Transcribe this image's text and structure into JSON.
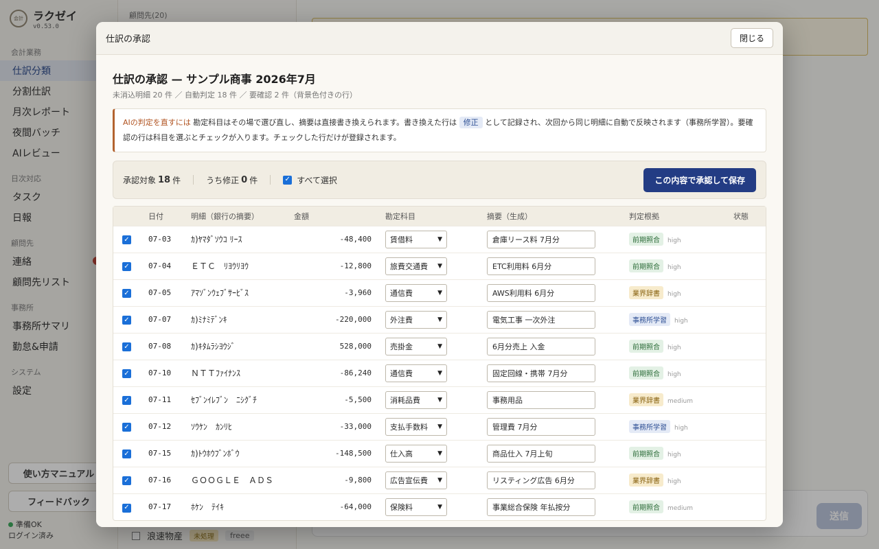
{
  "sidebar": {
    "logo_text": "会計",
    "brand": "ラクゼイ",
    "version": "v0.53.0",
    "groups": [
      {
        "label": "会計業務",
        "items": [
          "仕訳分類",
          "分割仕訳",
          "月次レポート",
          "夜間バッチ",
          "AIレビュー"
        ]
      },
      {
        "label": "日次対応",
        "items": [
          "タスク",
          "日報"
        ]
      },
      {
        "label": "顧問先",
        "items": [
          "連絡",
          "顧問先リスト"
        ]
      },
      {
        "label": "事務所",
        "items": [
          "事務所サマリ",
          "勤怠&申請"
        ]
      },
      {
        "label": "システム",
        "items": [
          "設定"
        ]
      }
    ],
    "manual_button": "使い方マニュアル",
    "feedback_button": "フィードバック",
    "status_ready": "準備OK",
    "status_login": "ログイン済み"
  },
  "clients": {
    "title": "顧問先(20)",
    "bottom_item": "浪速物産",
    "bottom_status": "未処理",
    "bottom_tag": "freee"
  },
  "composer": {
    "send_label": "送信"
  },
  "modal": {
    "header_title": "仕訳の承認",
    "close_label": "閉じる",
    "title": "仕訳の承認 — サンプル商事 2026年7月",
    "subtitle": "未消込明細 20 件 ／ 自動判定 18 件 ／ 要確認 2 件（背景色付きの行）",
    "hint": {
      "strong": "AIの判定を直すには",
      "text1": "勘定科目はその場で選び直し、摘要は直接書き換えられます。書き換えた行は",
      "chip": "修正",
      "text2": "として記録され、次回から同じ明細に自動で反映されます（事務所学習）。要確認の行は科目を選ぶとチェックが入ります。チェックした行だけが登録されます。"
    },
    "action_bar": {
      "target_label": "承認対象",
      "target_count": "18",
      "target_unit": "件",
      "modified_label": "うち修正",
      "modified_count": "0",
      "modified_unit": "件",
      "select_all": "すべて選択",
      "approve_button": "この内容で承認して保存"
    },
    "table": {
      "headers": [
        "",
        "日付",
        "明細（銀行の摘要）",
        "金額",
        "勘定科目",
        "摘要（生成）",
        "判定根拠",
        "状態"
      ],
      "rows": [
        {
          "date": "07-03",
          "desc": "ｶ)ﾔﾏﾀﾞｿｳｺ ﾘｰｽ",
          "amount": "-48,400",
          "account": "賃借料",
          "memo": "倉庫リース料 7月分",
          "basis": "前期照合",
          "basis_type": "green",
          "confidence": "high"
        },
        {
          "date": "07-04",
          "desc": "ＥＴＣ　ﾘﾖｳﾘﾖｳ",
          "amount": "-12,800",
          "account": "旅費交通費",
          "memo": "ETC利用料 6月分",
          "basis": "前期照合",
          "basis_type": "green",
          "confidence": "high"
        },
        {
          "date": "07-05",
          "desc": "ｱﾏｿﾞﾝｳｪﾌﾞｻｰﾋﾞｽ",
          "amount": "-3,960",
          "account": "通信費",
          "memo": "AWS利用料 6月分",
          "basis": "業界辞書",
          "basis_type": "amber",
          "confidence": "high"
        },
        {
          "date": "07-07",
          "desc": "ｶ)ﾐﾅﾐﾃﾞﾝｷ",
          "amount": "-220,000",
          "account": "外注費",
          "memo": "電気工事 一次外注",
          "basis": "事務所学習",
          "basis_type": "blue",
          "confidence": "high"
        },
        {
          "date": "07-08",
          "desc": "ｶ)ｷﾀﾑﾗｼﾖｳｼﾞ",
          "amount": "528,000",
          "account": "売掛金",
          "memo": "6月分売上 入金",
          "basis": "前期照合",
          "basis_type": "green",
          "confidence": "high"
        },
        {
          "date": "07-10",
          "desc": "ＮＴＴﾌｧｲﾅﾝｽ",
          "amount": "-86,240",
          "account": "通信費",
          "memo": "固定回線・携帯 7月分",
          "basis": "前期照合",
          "basis_type": "green",
          "confidence": "high"
        },
        {
          "date": "07-11",
          "desc": "ｾﾌﾞﾝｲﾚﾌﾞﾝ　ﾆｼｸﾞﾁ",
          "amount": "-5,500",
          "account": "消耗品費",
          "memo": "事務用品",
          "basis": "業界辞書",
          "basis_type": "amber",
          "confidence": "medium"
        },
        {
          "date": "07-12",
          "desc": "ｿｳｹﾝ　ｶﾝﾘﾋ",
          "amount": "-33,000",
          "account": "支払手数料",
          "memo": "管理費 7月分",
          "basis": "事務所学習",
          "basis_type": "blue",
          "confidence": "high"
        },
        {
          "date": "07-15",
          "desc": "ｶ)ﾄｳﾎｳﾌﾞﾝﾎﾞｳ",
          "amount": "-148,500",
          "account": "仕入高",
          "memo": "商品仕入 7月上旬",
          "basis": "前期照合",
          "basis_type": "green",
          "confidence": "high"
        },
        {
          "date": "07-16",
          "desc": "ＧＯＯＧＬＥ　ＡＤＳ",
          "amount": "-9,800",
          "account": "広告宣伝費",
          "memo": "リスティング広告 6月分",
          "basis": "業界辞書",
          "basis_type": "amber",
          "confidence": "high"
        },
        {
          "date": "07-17",
          "desc": "ﾎｹﾝ　ﾃｲｷ",
          "amount": "-64,000",
          "account": "保険料",
          "memo": "事業総合保険 年払按分",
          "basis": "前期照合",
          "basis_type": "green",
          "confidence": "medium"
        }
      ]
    }
  }
}
